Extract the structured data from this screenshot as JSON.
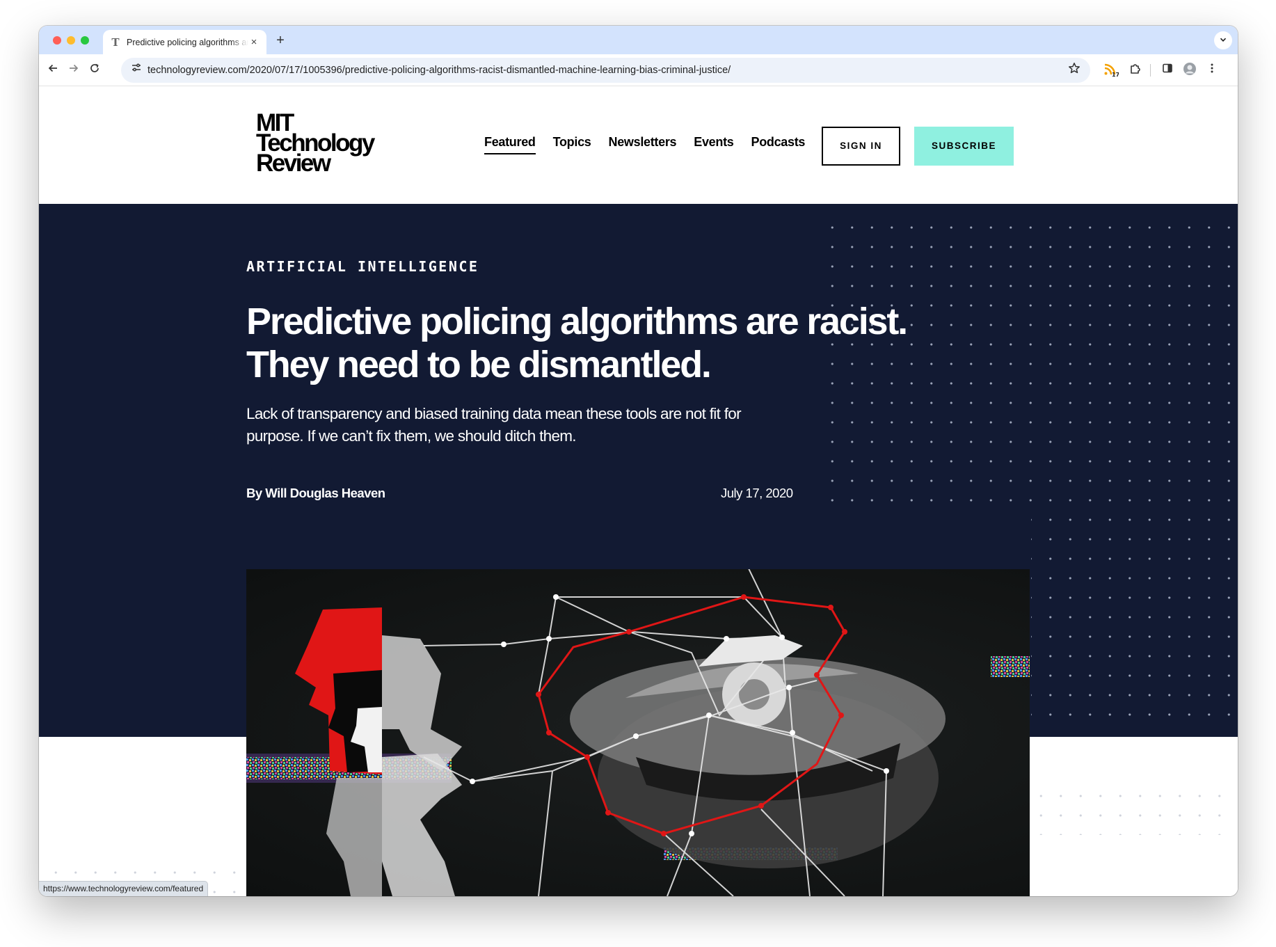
{
  "browser": {
    "tab_title": "Predictive policing algorithms are racist. They need to be dismantled.",
    "tab_close": "×",
    "new_tab": "+",
    "url": "technologyreview.com/2020/07/17/1005396/predictive-policing-algorithms-racist-dismantled-machine-learning-bias-criminal-justice/",
    "extension_badge": "17",
    "status_url": "https://www.technologyreview.com/featured"
  },
  "site": {
    "logo_lines": [
      "MIT",
      "Technology",
      "Review"
    ],
    "nav": {
      "featured": "Featured",
      "topics": "Topics",
      "newsletters": "Newsletters",
      "events": "Events",
      "podcasts": "Podcasts"
    },
    "sign_in": "SIGN IN",
    "subscribe": "SUBSCRIBE",
    "accent_color": "#8ff0e0",
    "hero_color": "#121a33"
  },
  "article": {
    "kicker": "ARTIFICIAL INTELLIGENCE",
    "headline": "Predictive policing algorithms are racist. They need to be dismantled.",
    "dek": "Lack of transparency and biased training data mean these tools are not fit for purpose. If we can’t fix them, we should ditch them.",
    "byline": "By Will Douglas Heaven",
    "date": "July 17, 2020"
  }
}
